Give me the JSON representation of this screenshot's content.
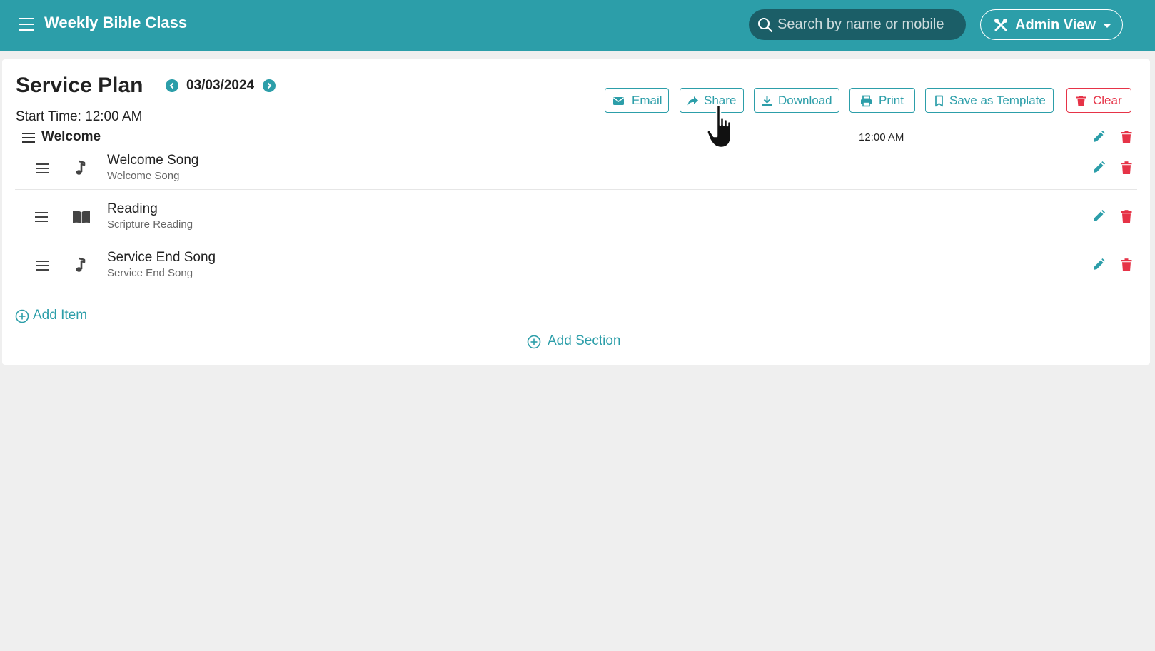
{
  "header": {
    "app_title": "Weekly Bible Class",
    "search": {
      "placeholder": "Search by name or mobile",
      "value": ""
    },
    "admin_view_label": "Admin View"
  },
  "plan": {
    "title": "Service Plan",
    "date": "03/03/2024",
    "start_time": "Start Time: 12:00 AM"
  },
  "toolbar": {
    "email_label": "Email",
    "share_label": "Share",
    "download_label": "Download",
    "print_label": "Print",
    "save_template_label": "Save as Template",
    "clear_label": "Clear"
  },
  "section": {
    "title": "Welcome",
    "time": "12:00 AM",
    "items": [
      {
        "title": "Welcome Song",
        "subtitle": "Welcome Song",
        "icon": "music-note-icon"
      },
      {
        "title": "Reading",
        "subtitle": "Scripture Reading",
        "icon": "book-open-icon"
      },
      {
        "title": "Service End Song",
        "subtitle": "Service End Song",
        "icon": "music-note-icon"
      }
    ]
  },
  "actions": {
    "add_item_label": "Add Item",
    "add_section_label": "Add Section"
  },
  "colors": {
    "primary": "#2c9ea9",
    "search_bg": "#1b5e67",
    "danger": "#e63347",
    "page_bg": "#efefef"
  }
}
